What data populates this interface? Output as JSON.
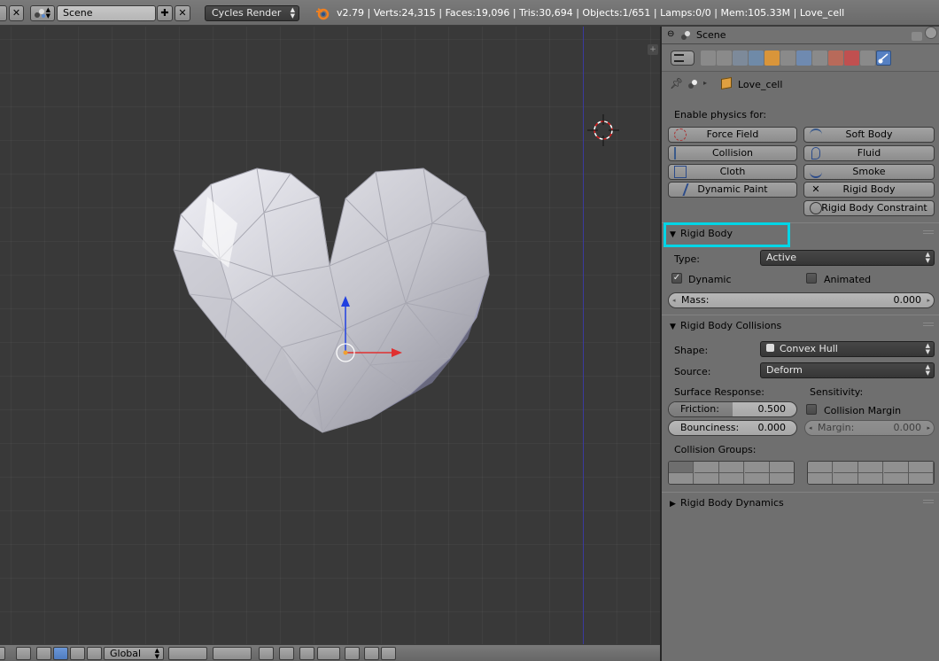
{
  "header": {
    "scene_name": "Scene",
    "render_engine": "Cycles Render",
    "stats": "v2.79 | Verts:24,315 | Faces:19,096 | Tris:30,694 | Objects:1/651 | Lamps:0/0 | Mem:105.33M | Love_cell"
  },
  "viewport": {
    "orientation": "Global"
  },
  "properties": {
    "outliner_scene": "Scene",
    "breadcrumb_object": "Love_cell",
    "active_tab": "physics",
    "enable_physics_label": "Enable physics for:",
    "physics_buttons": {
      "force_field": "Force Field",
      "soft_body": "Soft Body",
      "collision": "Collision",
      "fluid": "Fluid",
      "cloth": "Cloth",
      "smoke": "Smoke",
      "dynamic_paint": "Dynamic Paint",
      "rigid_body": "Rigid Body",
      "rigid_body_constraint": "Rigid Body Constraint"
    },
    "rigid_body": {
      "title": "Rigid Body",
      "type_label": "Type:",
      "type_value": "Active",
      "dynamic_label": "Dynamic",
      "dynamic_checked": true,
      "animated_label": "Animated",
      "animated_checked": false,
      "mass_label": "Mass:",
      "mass_value": "0.000"
    },
    "collisions": {
      "title": "Rigid Body Collisions",
      "shape_label": "Shape:",
      "shape_value": "Convex Hull",
      "source_label": "Source:",
      "source_value": "Deform",
      "surface_response_label": "Surface Response:",
      "sensitivity_label": "Sensitivity:",
      "friction_label": "Friction:",
      "friction_value": "0.500",
      "friction_fraction": 0.5,
      "collision_margin_label": "Collision Margin",
      "collision_margin_checked": false,
      "bounciness_label": "Bounciness:",
      "bounciness_value": "0.000",
      "margin_label": "Margin:",
      "margin_value": "0.000",
      "collision_groups_label": "Collision Groups:"
    },
    "dynamics": {
      "title": "Rigid Body Dynamics"
    }
  },
  "colors": {
    "highlight": "#00d5e6",
    "active_tab": "#5680c2",
    "x_axis": "#e03030",
    "z_axis": "#2040e0"
  }
}
